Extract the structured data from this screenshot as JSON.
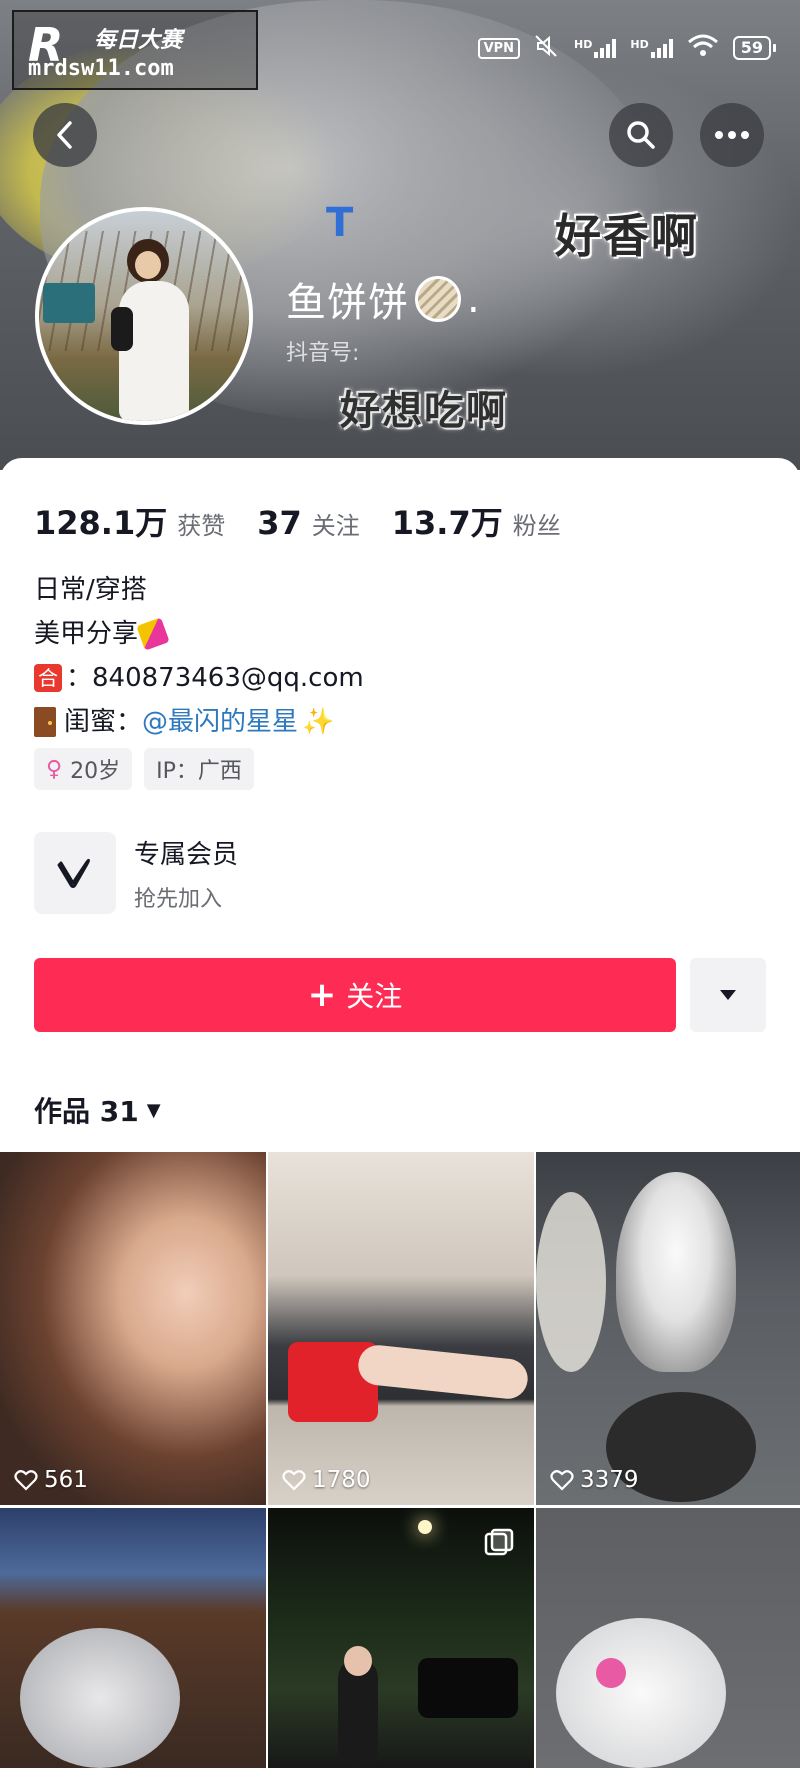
{
  "watermark": {
    "logo": "R",
    "cn": "每日大赛",
    "url": "mrdsw11.com"
  },
  "status_bar": {
    "vpn": "VPN",
    "hd1": "HD",
    "hd2": "HD",
    "battery": "59"
  },
  "cover": {
    "sticker_top": "好香啊",
    "sticker_bottom": "好想吃啊"
  },
  "icons": {
    "back": "back-icon",
    "search": "search-icon",
    "more": "more-icon",
    "heart": "heart-icon",
    "dropdown": "chevron-down-icon",
    "member": "v-logo-icon"
  },
  "profile": {
    "verified_mark": "T",
    "nickname": "鱼饼饼",
    "nickname_suffix": ".",
    "douyin_id_label": "抖音号:"
  },
  "stats": [
    {
      "value": "128.1万",
      "label": "获赞"
    },
    {
      "value": "37",
      "label": "关注"
    },
    {
      "value": "13.7万",
      "label": "粉丝"
    }
  ],
  "bio": {
    "line1": "日常/穿搭",
    "line2": "美甲分享",
    "contact_badge": "合",
    "contact": "：840873463@qq.com",
    "friend_label": "闺蜜：",
    "friend_mention": "@最闪的星星"
  },
  "tags": {
    "age": "20岁",
    "ip": "IP：广西",
    "gender_symbol": "♀"
  },
  "member": {
    "title": "专属会员",
    "subtitle": "抢先加入"
  },
  "actions": {
    "follow_plus": "+",
    "follow_label": "关注"
  },
  "works": {
    "label": "作品 31",
    "caret": "▼"
  },
  "videos": [
    {
      "likes": "561"
    },
    {
      "likes": "1780"
    },
    {
      "likes": "3379"
    },
    {
      "likes": ""
    },
    {
      "likes": ""
    },
    {
      "likes": ""
    }
  ],
  "colors": {
    "accent": "#fe2c55",
    "mention": "#2d79bf",
    "text": "#161823",
    "muted": "#6b6d74"
  }
}
